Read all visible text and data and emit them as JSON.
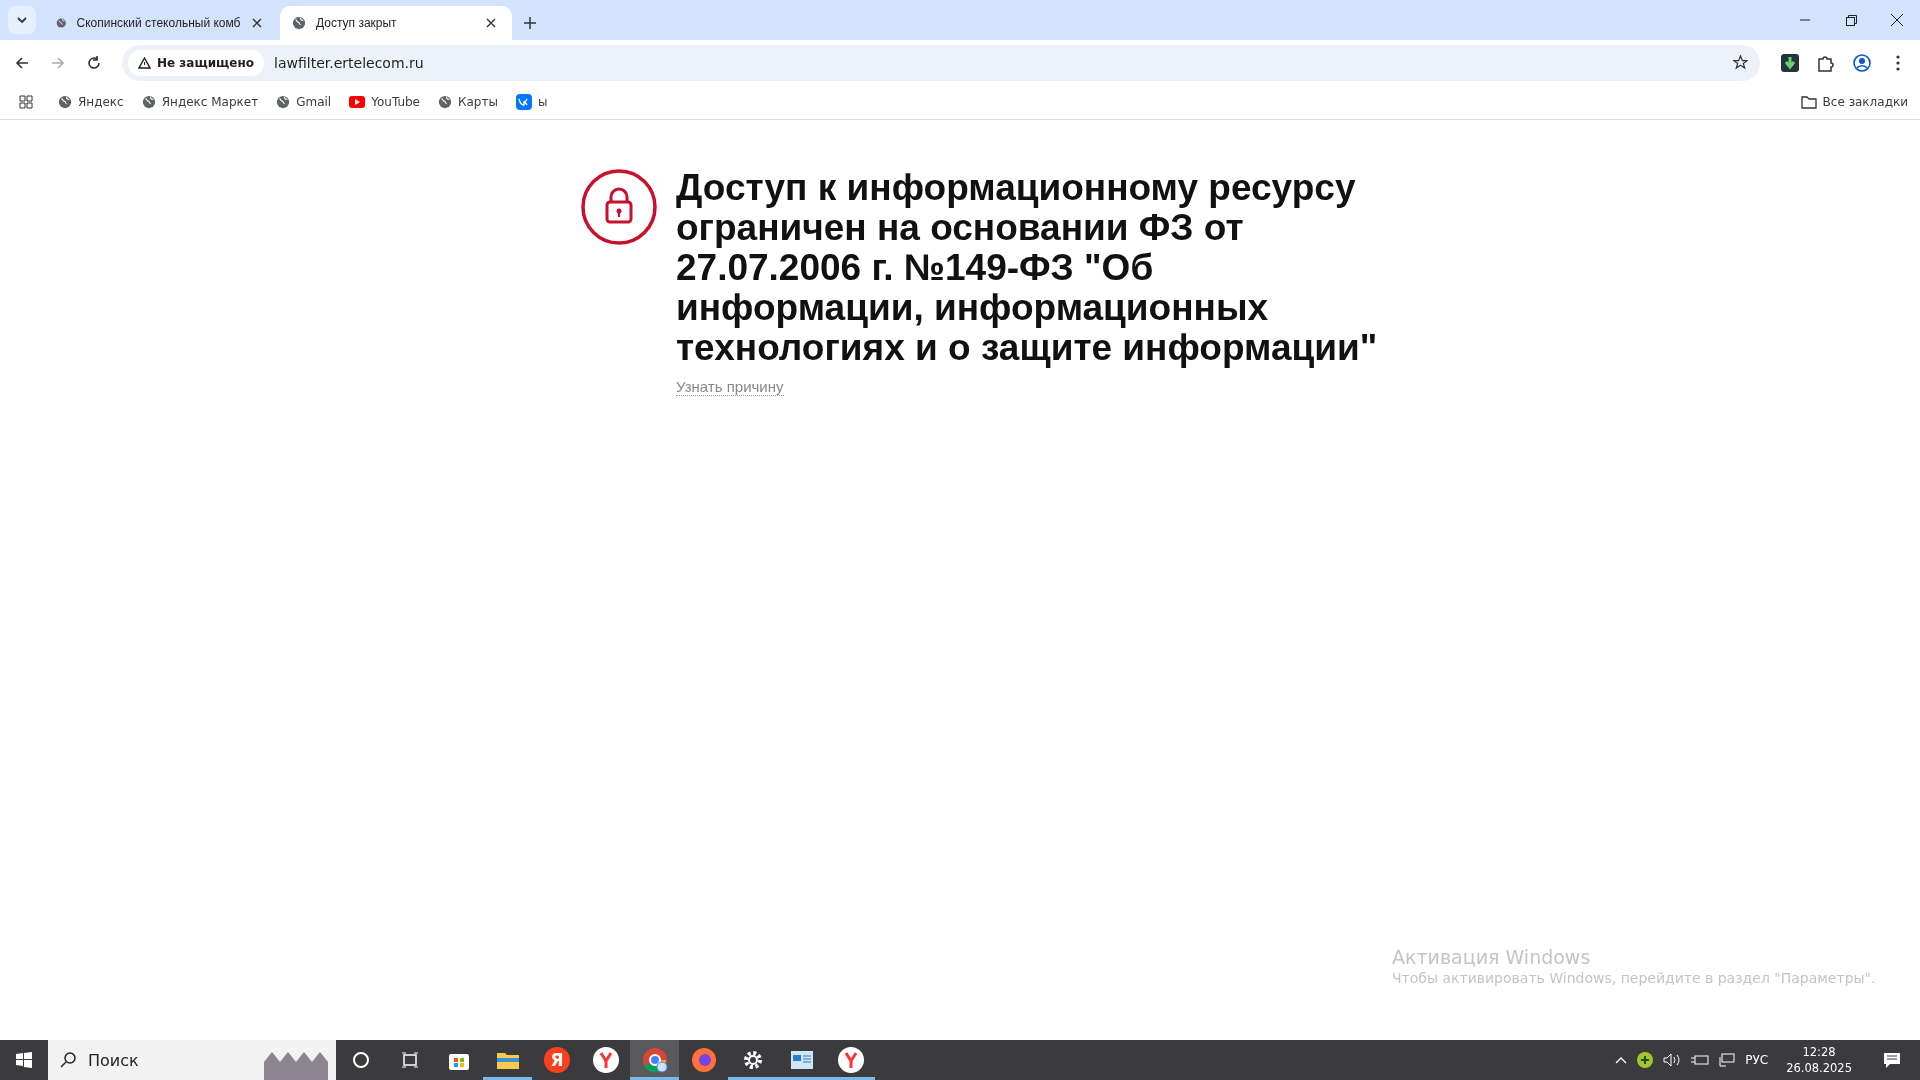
{
  "tabs": [
    {
      "title": "Скопинский стекольный комб",
      "selected": false
    },
    {
      "title": "Доступ закрыт",
      "selected": true
    }
  ],
  "address_bar": {
    "security": "Не защищено",
    "url": "lawfilter.ertelecom.ru"
  },
  "bookmarks": [
    {
      "kind": "globe",
      "label": "Яндекс"
    },
    {
      "kind": "globe",
      "label": "Яндекс Маркет"
    },
    {
      "kind": "globe",
      "label": "Gmail"
    },
    {
      "kind": "youtube",
      "label": "YouTube"
    },
    {
      "kind": "globe",
      "label": "Карты"
    },
    {
      "kind": "vk",
      "label": "ы"
    }
  ],
  "all_bookmarks": "Все закладки",
  "page": {
    "heading": "Доступ к информационному ресурсу ограничен на основании ФЗ от 27.07.2006 г. №149-ФЗ \"Об информации, информационных технологиях и о защите информации\"",
    "link": "Узнать причину"
  },
  "activation": {
    "title": "Активация Windows",
    "text": "Чтобы активировать Windows, перейдите в раздел \"Параметры\"."
  },
  "taskbar": {
    "search": {
      "placeholder": "Поиск"
    },
    "apps": [
      {
        "kind": "cortana",
        "open": false,
        "selected": false
      },
      {
        "kind": "taskview",
        "open": false,
        "selected": false
      },
      {
        "kind": "store",
        "open": false,
        "selected": false
      },
      {
        "kind": "folder",
        "open": true,
        "selected": false
      },
      {
        "kind": "yandex",
        "label": "Я",
        "open": false,
        "selected": false
      },
      {
        "kind": "ybrowser",
        "open": false,
        "selected": false
      },
      {
        "kind": "chrome",
        "open": true,
        "selected": true
      },
      {
        "kind": "firefox",
        "open": false,
        "selected": false
      },
      {
        "kind": "settings",
        "open": true,
        "selected": false
      },
      {
        "kind": "monitor",
        "open": true,
        "selected": false
      },
      {
        "kind": "ybrowser",
        "open": true,
        "selected": false
      }
    ],
    "language": "РУС",
    "time": "12:28",
    "date": "26.08.2025"
  }
}
